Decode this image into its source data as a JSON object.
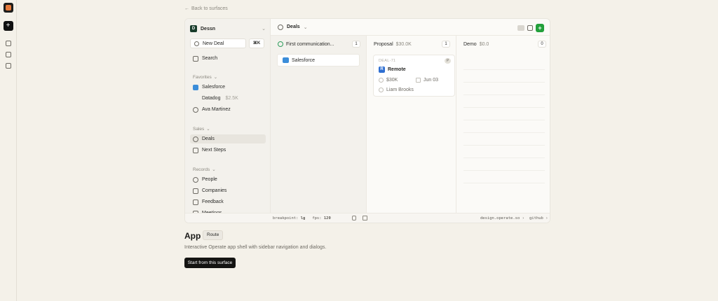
{
  "back_link": "Back to surfaces",
  "workspace": {
    "initial": "D",
    "name": "Dessn"
  },
  "sidebar": {
    "new_deal": "New Deal",
    "shortcut": "⌘K",
    "search": "Search",
    "favorites_label": "Favorites",
    "favorites": [
      {
        "label": "Salesforce",
        "icon": "salesforce-icon"
      },
      {
        "label": "Datadog",
        "amount": "$2.5K"
      },
      {
        "label": "Ava Martinez",
        "icon": "person-icon"
      }
    ],
    "sales_label": "Sales",
    "sales": [
      {
        "label": "Deals",
        "active": true
      },
      {
        "label": "Next Steps"
      }
    ],
    "records_label": "Records",
    "records": [
      {
        "label": "People"
      },
      {
        "label": "Companies"
      },
      {
        "label": "Feedback"
      },
      {
        "label": "Meetings"
      }
    ]
  },
  "topbar": {
    "view": "Deals"
  },
  "columns": [
    {
      "title": "First communication...",
      "count": "1"
    },
    {
      "title": "Proposal",
      "amount": "$30.0K",
      "count": "1"
    },
    {
      "title": "Demo",
      "amount": "$0.0",
      "count": "0"
    }
  ],
  "cards": {
    "first": {
      "company": "Salesforce"
    },
    "proposal": {
      "deal_id": "DEAL-71",
      "badge": "P",
      "company_initial": "R",
      "company": "Remote",
      "value": "$30K",
      "date": "Jun 03",
      "owner": "Liam Brooks"
    }
  },
  "status_bar": {
    "breakpoint_label": "breakpoint:",
    "breakpoint": "lg",
    "fps_label": "fps:",
    "fps": "120",
    "site": "design.operate.so",
    "repo": "github"
  },
  "surface": {
    "title": "App",
    "tag": "Route",
    "description": "Interactive Operate app shell with sidebar navigation and dialogs.",
    "cta": "Start from this surface"
  },
  "colors": {
    "accent_green": "#22a03b",
    "background": "#f4f1e9",
    "cta": "#141412"
  }
}
